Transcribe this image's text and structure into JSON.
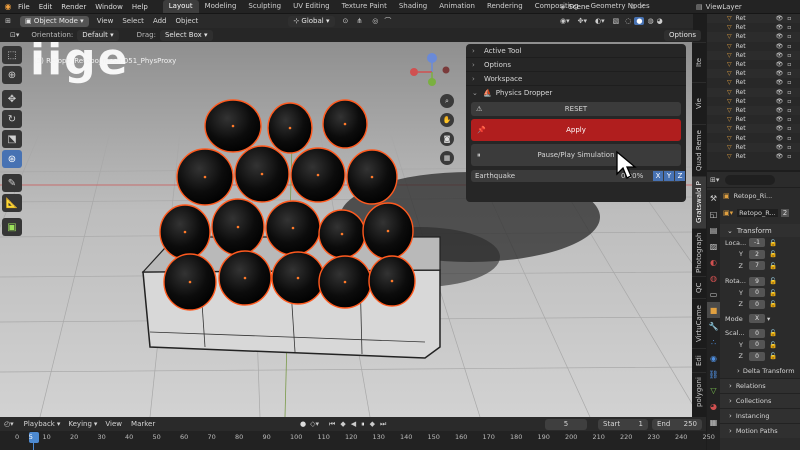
{
  "topbar": {
    "menus": [
      "File",
      "Edit",
      "Render",
      "Window",
      "Help"
    ],
    "workspaces": [
      "Layout",
      "Modeling",
      "Sculpting",
      "UV Editing",
      "Texture Paint",
      "Shading",
      "Animation",
      "Rendering",
      "Compositing",
      "Geometry Nodes"
    ],
    "active_workspace": "Layout",
    "scene_label": "Scene",
    "viewlayer_label": "ViewLayer"
  },
  "viewport_header": {
    "mode": "Object Mode",
    "menus": [
      "View",
      "Select",
      "Add",
      "Object"
    ],
    "transform_orientation": "Global",
    "orientation_label": "Orientation:",
    "orientation_value": "Default",
    "drag_label": "Drag:",
    "drag_value": "Select Box",
    "options_label": "Options"
  },
  "viewport": {
    "object_info": "(5) Retopo_Retopo_mesh.051_PhysProxy",
    "watermark": "iige"
  },
  "npanel": {
    "sections": [
      "Active Tool",
      "Options",
      "Workspace"
    ],
    "addon_title": "Physics Dropper",
    "reset_label": "RESET",
    "apply_label": "Apply",
    "pause_label": "Pause/Play Simulation",
    "earthquake_label": "Earthquake",
    "earthquake_value": "0.00%",
    "axis_labels": [
      "X",
      "Y",
      "Z"
    ]
  },
  "vertical_tabs": [
    "Ite",
    "Vie",
    "Quad Reme",
    "Gratswald P",
    "Photograph",
    "QC",
    "VirtuCame",
    "Edi",
    "polygoni"
  ],
  "outliner": {
    "items": [
      "Ret",
      "Ret",
      "Ret",
      "Ret",
      "Ret",
      "Ret",
      "Ret",
      "Ret",
      "Ret",
      "Ret",
      "Ret",
      "Ret",
      "Ret",
      "Ret",
      "Ret",
      "Ret"
    ]
  },
  "properties": {
    "object_name": "Retopo_Ri...",
    "data_name": "Retopo_R...",
    "user_count": "2",
    "transform_label": "Transform",
    "location_label": "Loca...",
    "location": [
      "-1",
      "2",
      "7"
    ],
    "rotation_label": "Rota...",
    "rotation": [
      "9",
      "0",
      "0"
    ],
    "mode_label": "Mode",
    "mode_value": "X",
    "scale_label": "Scal...",
    "scale": [
      "0",
      "0",
      "0"
    ],
    "axis": [
      "X",
      "Y",
      "Z"
    ],
    "subsections": [
      "Delta Transform",
      "Relations",
      "Collections",
      "Instancing",
      "Motion Paths"
    ]
  },
  "timeline": {
    "menus": [
      "Playback",
      "Keying",
      "View",
      "Marker"
    ],
    "current_frame": "5",
    "start_label": "Start",
    "start_value": "1",
    "end_label": "End",
    "end_value": "250",
    "ruler": [
      "0",
      "5",
      "10",
      "20",
      "30",
      "40",
      "50",
      "60",
      "70",
      "80",
      "90",
      "100",
      "110",
      "120",
      "130",
      "140",
      "150",
      "160",
      "170",
      "180",
      "190",
      "200",
      "210",
      "220",
      "230",
      "240",
      "250"
    ]
  },
  "colors": {
    "accent_blue": "#4772b3",
    "apply_red": "#b01e1e",
    "selection_orange": "#ff5a1f",
    "timeline_cursor": "#4d8ad1"
  }
}
